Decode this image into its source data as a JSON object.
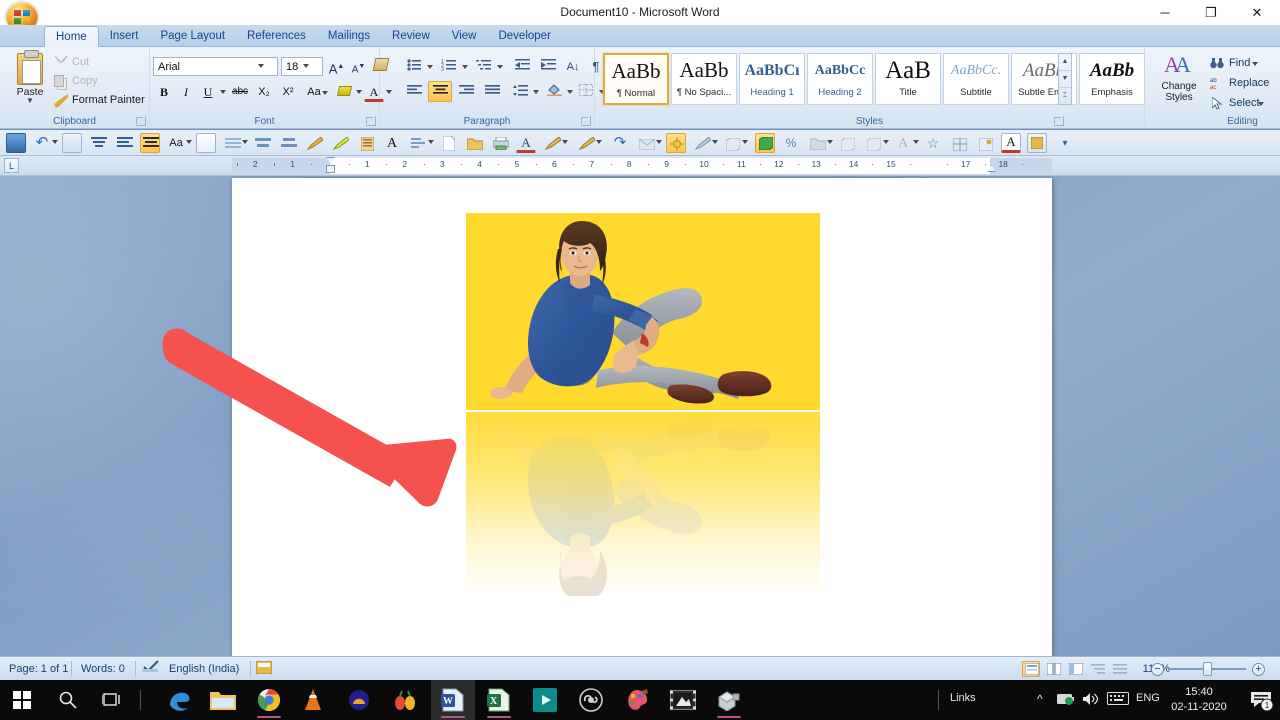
{
  "window": {
    "title": "Document10 - Microsoft Word",
    "minimize": "─",
    "restore": "❐",
    "close": "✕",
    "office_button": "office-orb"
  },
  "ribbon": {
    "tabs": [
      {
        "label": "Home",
        "active": true
      },
      {
        "label": "Insert",
        "active": false
      },
      {
        "label": "Page Layout",
        "active": false
      },
      {
        "label": "References",
        "active": false
      },
      {
        "label": "Mailings",
        "active": false
      },
      {
        "label": "Review",
        "active": false
      },
      {
        "label": "View",
        "active": false
      },
      {
        "label": "Developer",
        "active": false
      }
    ],
    "groups": {
      "clipboard": {
        "label": "Clipboard",
        "paste": "Paste",
        "cut": "Cut",
        "copy": "Copy",
        "format_painter": "Format Painter"
      },
      "font": {
        "label": "Font",
        "font_name": "Arial",
        "font_size": "18",
        "bold": "B",
        "italic": "I",
        "underline": "U",
        "strikethrough": "abc",
        "subscript": "X₂",
        "superscript": "X²",
        "change_case": "Aa",
        "grow_font": "A",
        "shrink_font": "A",
        "clear_formatting": "clear-formatting-icon",
        "highlight": "text-highlight-icon",
        "font_color": "A"
      },
      "paragraph": {
        "label": "Paragraph",
        "bullets": "bullet-list-icon",
        "numbering": "numbered-list-icon",
        "multilevel": "multilevel-list-icon",
        "decrease_indent": "decrease-indent-icon",
        "increase_indent": "increase-indent-icon",
        "sort": "sort-icon",
        "show_marks": "¶",
        "align_left": "align-left-icon",
        "align_center": "align-center-icon",
        "align_right": "align-right-icon",
        "justify": "justify-icon",
        "line_spacing": "line-spacing-icon",
        "shading": "shading-icon",
        "borders": "borders-icon",
        "active_alignment": "align_center"
      },
      "styles": {
        "label": "Styles",
        "items": [
          {
            "preview": "AaBb",
            "name": "¶ Normal",
            "selected": true
          },
          {
            "preview": "AaBb",
            "name": "¶ No Spaci...",
            "selected": false
          },
          {
            "preview": "AaBbCı",
            "name": "Heading 1",
            "selected": false
          },
          {
            "preview": "AaBbCc",
            "name": "Heading 2",
            "selected": false
          },
          {
            "preview": "AaB",
            "name": "Title",
            "selected": false
          },
          {
            "preview": "AaBbCc.",
            "name": "Subtitle",
            "selected": false
          },
          {
            "preview": "AaBb",
            "name": "Subtle Em...",
            "selected": false
          },
          {
            "preview": "AaBb",
            "name": "Emphasis",
            "selected": false
          }
        ],
        "change_styles": "Change Styles"
      },
      "editing": {
        "label": "Editing",
        "find": "Find",
        "replace": "Replace",
        "select": "Select"
      }
    }
  },
  "quick_toolbar": {
    "items": [
      "save-icon",
      "undo-icon",
      "undo-dropdown",
      "print-preview-icon",
      "align-top-icon",
      "align-middle-icon",
      "align-bottom-icon",
      "change-case-icon",
      "edit-icon",
      "text-box-icon",
      "shape-fill-icon",
      "shape-outline-icon",
      "format-painter-icon",
      "highlight-icon",
      "columns-icon",
      "text-effects-icon",
      "page-setup-icon",
      "new-doc-icon",
      "open-doc-icon",
      "print-icon",
      "font-color-icon",
      "picture-tools-icon",
      "picture-border-icon",
      "picture-effects-icon",
      "redo-icon",
      "envelope-icon",
      "brightness-icon",
      "contrast-icon",
      "3d-style-icon",
      "3d-color-icon",
      "percent-icon",
      "shadow-icon",
      "shape-icon-1",
      "shape-icon-2",
      "wordart-icon",
      "star-icon",
      "insert-table-icon",
      "attach-icon",
      "font-color-red-icon",
      "object-icon",
      "toolbar-overflow-icon"
    ]
  },
  "ruler": {
    "corner_label": "L",
    "left_numbers": [
      "2",
      "1"
    ],
    "numbers": [
      "1",
      "2",
      "3",
      "4",
      "5",
      "6",
      "7",
      "8",
      "9",
      "10",
      "11",
      "12",
      "13",
      "14",
      "15",
      "17",
      "18"
    ]
  },
  "document": {
    "photo": {
      "background_color": "#ffd92e",
      "subject": "man-sitting-photo",
      "has_reflection": true,
      "reflection_label": "mirrored-reflection"
    },
    "annotation": {
      "type": "arrow",
      "color": "#f4514f",
      "points_to": "reflection-image"
    }
  },
  "status_bar": {
    "page": "Page: 1 of 1",
    "words": "Words: 0",
    "proofing_icon": "spell-check-icon",
    "language": "English (India)",
    "macro_icon": "macro-record-icon",
    "views": [
      {
        "name": "print-layout-view",
        "active": true
      },
      {
        "name": "full-screen-reading-view",
        "active": false
      },
      {
        "name": "web-layout-view",
        "active": false
      },
      {
        "name": "outline-view",
        "active": false
      },
      {
        "name": "draft-view",
        "active": false
      }
    ],
    "zoom": "110%",
    "zoom_out": "−",
    "zoom_in": "+"
  },
  "taskbar": {
    "start": "windows-start-icon",
    "search": "search-icon",
    "task_view": "task-view-icon",
    "apps": [
      {
        "name": "microsoft-edge",
        "running": false
      },
      {
        "name": "file-explorer",
        "running": false
      },
      {
        "name": "google-chrome",
        "running": true
      },
      {
        "name": "vlc-media-player",
        "running": false
      },
      {
        "name": "app-orange",
        "running": false
      },
      {
        "name": "app-fruit",
        "running": false
      },
      {
        "name": "microsoft-word",
        "running": true,
        "active": true
      },
      {
        "name": "microsoft-excel",
        "running": true
      },
      {
        "name": "movies-and-tv",
        "running": false
      },
      {
        "name": "obs-studio",
        "running": false
      },
      {
        "name": "paint-3d",
        "running": false
      },
      {
        "name": "video-editor",
        "running": false
      },
      {
        "name": "3d-builder",
        "running": true
      }
    ],
    "links_label": "Links",
    "tray": {
      "show_hidden": "chevron-up-icon",
      "battery": "battery-icon",
      "volume": "volume-icon",
      "keyboard": "touch-keyboard-icon",
      "language": "ENG",
      "time": "15:40",
      "date": "02-11-2020",
      "notifications": "notification-icon",
      "notification_count": "1"
    }
  }
}
